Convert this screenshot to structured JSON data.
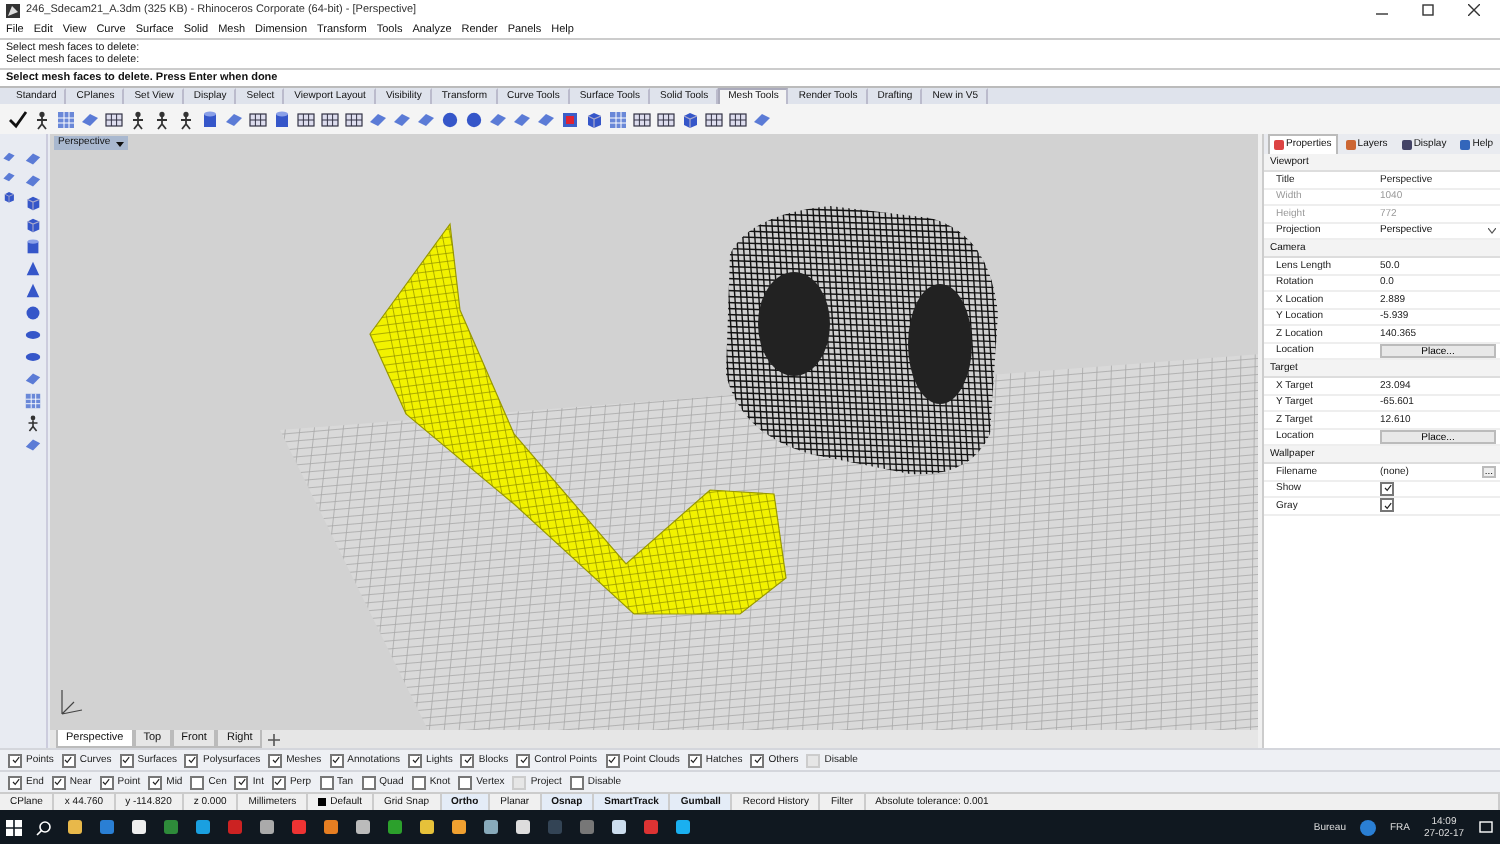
{
  "window": {
    "title": "246_Sdecam21_A.3dm (325 KB) - Rhinoceros Corporate (64-bit) - [Perspective]"
  },
  "menu": [
    "File",
    "Edit",
    "View",
    "Curve",
    "Surface",
    "Solid",
    "Mesh",
    "Dimension",
    "Transform",
    "Tools",
    "Analyze",
    "Render",
    "Panels",
    "Help"
  ],
  "command_history": [
    "Select mesh faces to delete:",
    "Select mesh faces to delete:"
  ],
  "command_prompt": "Select mesh faces to delete. Press Enter when done",
  "toolbar_tabs": [
    {
      "label": "Standard",
      "selected": false
    },
    {
      "label": "CPlanes",
      "selected": false
    },
    {
      "label": "Set View",
      "selected": false
    },
    {
      "label": "Display",
      "selected": false
    },
    {
      "label": "Select",
      "selected": false
    },
    {
      "label": "Viewport Layout",
      "selected": false
    },
    {
      "label": "Visibility",
      "selected": false
    },
    {
      "label": "Transform",
      "selected": false
    },
    {
      "label": "Curve Tools",
      "selected": false
    },
    {
      "label": "Surface Tools",
      "selected": false
    },
    {
      "label": "Solid Tools",
      "selected": false
    },
    {
      "label": "Mesh Tools",
      "selected": true
    },
    {
      "label": "Render Tools",
      "selected": false
    },
    {
      "label": "Drafting",
      "selected": false
    },
    {
      "label": "New in V5",
      "selected": false
    }
  ],
  "viewport": {
    "label": "Perspective"
  },
  "viewport_tabs": [
    {
      "label": "Perspective",
      "selected": true
    },
    {
      "label": "Top",
      "selected": false
    },
    {
      "label": "Front",
      "selected": false
    },
    {
      "label": "Right",
      "selected": false
    }
  ],
  "panel": {
    "tabs": [
      {
        "label": "Properties",
        "selected": true
      },
      {
        "label": "Layers",
        "selected": false
      },
      {
        "label": "Display",
        "selected": false
      },
      {
        "label": "Help",
        "selected": false
      }
    ],
    "sections": [
      {
        "title": "Viewport",
        "rows": [
          {
            "label": "Title",
            "value": "Perspective",
            "kind": "text",
            "disabled": false
          },
          {
            "label": "Width",
            "value": "1040",
            "kind": "text",
            "disabled": true
          },
          {
            "label": "Height",
            "value": "772",
            "kind": "text",
            "disabled": true
          },
          {
            "label": "Projection",
            "value": "Perspective",
            "kind": "dropdown",
            "disabled": false
          }
        ]
      },
      {
        "title": "Camera",
        "rows": [
          {
            "label": "Lens Length",
            "value": "50.0",
            "kind": "text",
            "disabled": false
          },
          {
            "label": "Rotation",
            "value": "0.0",
            "kind": "text",
            "disabled": false
          },
          {
            "label": "X Location",
            "value": "2.889",
            "kind": "text",
            "disabled": false
          },
          {
            "label": "Y Location",
            "value": "-5.939",
            "kind": "text",
            "disabled": false
          },
          {
            "label": "Z Location",
            "value": "140.365",
            "kind": "text",
            "disabled": false
          },
          {
            "label": "Location",
            "value": "Place...",
            "kind": "button",
            "disabled": false
          }
        ]
      },
      {
        "title": "Target",
        "rows": [
          {
            "label": "X Target",
            "value": "23.094",
            "kind": "text",
            "disabled": false
          },
          {
            "label": "Y Target",
            "value": "-65.601",
            "kind": "text",
            "disabled": false
          },
          {
            "label": "Z Target",
            "value": "12.610",
            "kind": "text",
            "disabled": false
          },
          {
            "label": "Location",
            "value": "Place...",
            "kind": "button",
            "disabled": false
          }
        ]
      },
      {
        "title": "Wallpaper",
        "rows": [
          {
            "label": "Filename",
            "value": "(none)",
            "kind": "file",
            "button": "...",
            "disabled": false
          },
          {
            "label": "Show",
            "checked": true,
            "kind": "checkbox",
            "disabled": false
          },
          {
            "label": "Gray",
            "checked": true,
            "kind": "checkbox",
            "disabled": false
          }
        ]
      }
    ]
  },
  "filters": [
    [
      {
        "label": "Points",
        "checked": true,
        "disabled": false
      },
      {
        "label": "Curves",
        "checked": true,
        "disabled": false
      },
      {
        "label": "Surfaces",
        "checked": true,
        "disabled": false
      },
      {
        "label": "Polysurfaces",
        "checked": true,
        "disabled": false
      },
      {
        "label": "Meshes",
        "checked": true,
        "disabled": false
      },
      {
        "label": "Annotations",
        "checked": true,
        "disabled": false
      },
      {
        "label": "Lights",
        "checked": true,
        "disabled": false
      },
      {
        "label": "Blocks",
        "checked": true,
        "disabled": false
      },
      {
        "label": "Control Points",
        "checked": true,
        "disabled": false
      },
      {
        "label": "Point Clouds",
        "checked": true,
        "disabled": false
      },
      {
        "label": "Hatches",
        "checked": true,
        "disabled": false
      },
      {
        "label": "Others",
        "checked": true,
        "disabled": false
      },
      {
        "label": "Disable",
        "checked": false,
        "disabled": true
      }
    ],
    [
      {
        "label": "End",
        "checked": true,
        "disabled": false
      },
      {
        "label": "Near",
        "checked": true,
        "disabled": false
      },
      {
        "label": "Point",
        "checked": true,
        "disabled": false
      },
      {
        "label": "Mid",
        "checked": true,
        "disabled": false
      },
      {
        "label": "Cen",
        "checked": false,
        "disabled": false
      },
      {
        "label": "Int",
        "checked": true,
        "disabled": false
      },
      {
        "label": "Perp",
        "checked": true,
        "disabled": false
      },
      {
        "label": "Tan",
        "checked": false,
        "disabled": false
      },
      {
        "label": "Quad",
        "checked": false,
        "disabled": false
      },
      {
        "label": "Knot",
        "checked": false,
        "disabled": false
      },
      {
        "label": "Vertex",
        "checked": false,
        "disabled": false
      },
      {
        "label": "Project",
        "checked": false,
        "disabled": true
      },
      {
        "label": "Disable",
        "checked": false,
        "disabled": false
      }
    ]
  ],
  "status_bar": [
    {
      "kind": "text",
      "label": "CPlane"
    },
    {
      "kind": "text",
      "label": "x 44.760"
    },
    {
      "kind": "text",
      "label": "y -114.820"
    },
    {
      "kind": "text",
      "label": "z 0.000"
    },
    {
      "kind": "text",
      "label": "Millimeters"
    },
    {
      "kind": "layer",
      "label": "Default",
      "color": "#000000"
    },
    {
      "kind": "toggle",
      "label": "Grid Snap",
      "on": false
    },
    {
      "kind": "toggle",
      "label": "Ortho",
      "on": true
    },
    {
      "kind": "toggle",
      "label": "Planar",
      "on": false
    },
    {
      "kind": "toggle",
      "label": "Osnap",
      "on": true
    },
    {
      "kind": "toggle",
      "label": "SmartTrack",
      "on": true
    },
    {
      "kind": "toggle",
      "label": "Gumball",
      "on": true
    },
    {
      "kind": "toggle",
      "label": "Record History",
      "on": false
    },
    {
      "kind": "toggle",
      "label": "Filter",
      "on": false
    },
    {
      "kind": "text",
      "label": "Absolute tolerance: 0.001"
    }
  ],
  "taskbar": {
    "label": "Bureau",
    "language": "FRA",
    "time": "14:09",
    "date": "27-02-17"
  }
}
